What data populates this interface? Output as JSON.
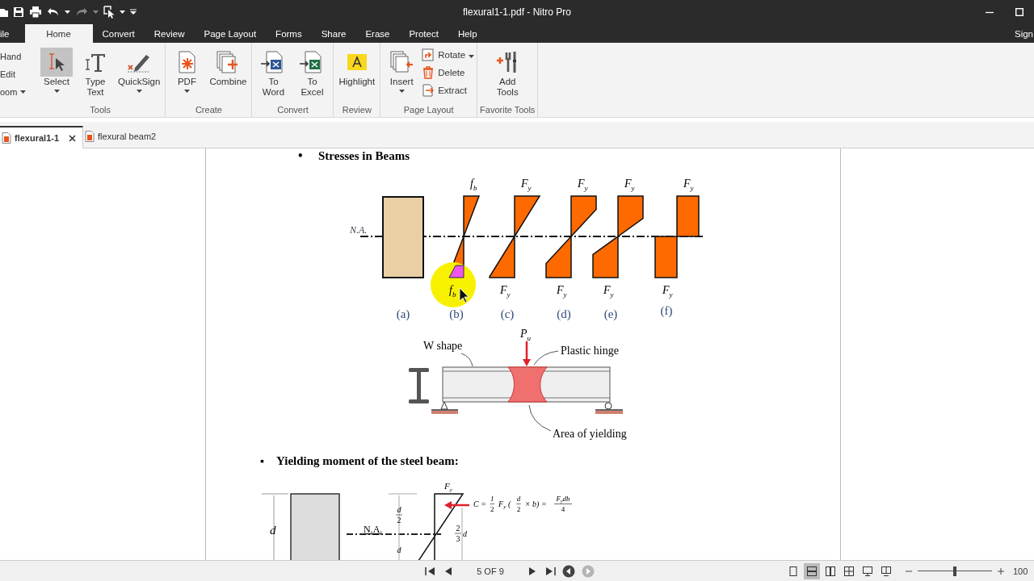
{
  "title_bar": {
    "title": "flexural1-1.pdf - Nitro Pro"
  },
  "menu_tabs": [
    {
      "label": "ile",
      "selected": false
    },
    {
      "label": "Home",
      "selected": true
    },
    {
      "label": "Convert",
      "selected": false
    },
    {
      "label": "Review",
      "selected": false
    },
    {
      "label": "Page Layout",
      "selected": false
    },
    {
      "label": "Forms",
      "selected": false
    },
    {
      "label": "Share",
      "selected": false
    },
    {
      "label": "Erase",
      "selected": false
    },
    {
      "label": "Protect",
      "selected": false
    },
    {
      "label": "Help",
      "selected": false
    }
  ],
  "account_link": "Sign",
  "quick_tools": [
    {
      "label": "Hand",
      "has_menu": false
    },
    {
      "label": "Edit",
      "has_menu": false
    },
    {
      "label": "oom",
      "has_menu": true
    }
  ],
  "ribbon_groups": [
    {
      "label": "Tools",
      "buttons": [
        {
          "kind": "select",
          "lines": [
            "Select"
          ],
          "selected": true,
          "has_menu": true
        },
        {
          "kind": "type-text",
          "lines": [
            "Type",
            "Text"
          ],
          "selected": false,
          "has_menu": false
        },
        {
          "kind": "quicksign",
          "lines": [
            "QuickSign"
          ],
          "selected": false,
          "has_menu": true
        }
      ]
    },
    {
      "label": "Create",
      "buttons": [
        {
          "kind": "pdf",
          "lines": [
            "PDF"
          ],
          "selected": false,
          "has_menu": true
        },
        {
          "kind": "combine",
          "lines": [
            "Combine"
          ],
          "selected": false,
          "has_menu": false
        }
      ]
    },
    {
      "label": "Convert",
      "buttons": [
        {
          "kind": "to-word",
          "lines": [
            "To",
            "Word"
          ],
          "selected": false,
          "has_menu": false
        },
        {
          "kind": "to-excel",
          "lines": [
            "To",
            "Excel"
          ],
          "selected": false,
          "has_menu": false
        }
      ]
    },
    {
      "label": "Review",
      "buttons": [
        {
          "kind": "highlight",
          "lines": [
            "Highlight"
          ],
          "selected": false,
          "has_menu": false
        }
      ]
    },
    {
      "label": "Page Layout",
      "buttons": [
        {
          "kind": "insert",
          "lines": [
            "Insert"
          ],
          "selected": false,
          "has_menu": true
        },
        {
          "kind": "rotate",
          "lines": [
            "Rotate"
          ],
          "selected": false,
          "has_menu": true
        },
        {
          "kind": "delete",
          "lines": [
            "Delete"
          ],
          "selected": false,
          "has_menu": false
        },
        {
          "kind": "extract",
          "lines": [
            "Extract"
          ],
          "selected": false,
          "has_menu": false
        }
      ]
    },
    {
      "label": "Favorite Tools",
      "buttons": [
        {
          "kind": "add-tools",
          "lines": [
            "Add",
            "Tools"
          ],
          "selected": false,
          "has_menu": false
        }
      ]
    }
  ],
  "doc_tabs": [
    {
      "label": "flexural1-1",
      "selected": true,
      "closable": true
    },
    {
      "label": "flexural beam2",
      "selected": false,
      "closable": false
    }
  ],
  "document": {
    "heading_1": {
      "bullet": "•",
      "text": "Stresses in Beams"
    },
    "stress_figure": {
      "na_label": "N.A.",
      "profiles": [
        {
          "kind": "section",
          "caption": "(a)"
        },
        {
          "kind": "elastic",
          "top": {
            "symbol": "f",
            "subscript": "b"
          },
          "bottom": {
            "symbol": "f",
            "subscript": "b"
          },
          "caption": "(b)"
        },
        {
          "kind": "first-yield",
          "top": {
            "symbol": "F",
            "subscript": "y"
          },
          "bottom": {
            "symbol": "F",
            "subscript": "y"
          },
          "caption": "(c)"
        },
        {
          "kind": "partial-yield",
          "top": {
            "symbol": "F",
            "subscript": "y"
          },
          "bottom": {
            "symbol": "F",
            "subscript": "y"
          },
          "caption": "(d)"
        },
        {
          "kind": "deep-yield",
          "top": {
            "symbol": "F",
            "subscript": "y"
          },
          "bottom": {
            "symbol": "F",
            "subscript": "y"
          },
          "caption": "(e)"
        },
        {
          "kind": "plastic",
          "top": {
            "symbol": "F",
            "subscript": "y"
          },
          "bottom": {
            "symbol": "F",
            "subscript": "y"
          },
          "caption": "(f)"
        }
      ]
    },
    "beam_figure": {
      "load_label": {
        "symbol": "P",
        "subscript": "u"
      },
      "section_label": "W shape",
      "hinge_label": "Plastic hinge",
      "yield_label": "Area of yielding"
    },
    "heading_2": {
      "bullet": "▪",
      "text": "Yielding moment of the steel beam:"
    },
    "moment_figure": {
      "depth_label": "d",
      "na_label": "N.A.",
      "stress_label": {
        "symbol": "F",
        "subscript": "y"
      },
      "half_depths": [
        {
          "numerator": "d",
          "denominator": "2"
        },
        {
          "numerator": "d"
        }
      ],
      "lever_arm": {
        "numerator": "2",
        "denominator": "3",
        "rest": "d"
      },
      "formula": [
        {
          "kind": "text",
          "text": "C ="
        },
        {
          "kind": "frac",
          "numerator": "1",
          "denominator": "2"
        },
        {
          "kind": "sym",
          "symbol": "F",
          "subscript": "y"
        },
        {
          "kind": "text",
          "text": "("
        },
        {
          "kind": "frac",
          "numerator": "d",
          "denominator": "2"
        },
        {
          "kind": "text",
          "text": "× b) ="
        },
        {
          "kind": "frac",
          "symbol": "F",
          "subscript": "y",
          "numerator": "db",
          "denominator": "4"
        }
      ]
    }
  },
  "status_bar": {
    "nav": [
      {
        "kind": "first"
      },
      {
        "kind": "prev"
      }
    ],
    "page_field": "5 OF 9",
    "nav_after": [
      {
        "kind": "next"
      },
      {
        "kind": "last"
      }
    ],
    "history": [
      {
        "kind": "back",
        "disabled": false
      },
      {
        "kind": "forward",
        "disabled": true
      }
    ],
    "view_modes": [
      {
        "kind": "single",
        "selected": false
      },
      {
        "kind": "continuous",
        "selected": true
      },
      {
        "kind": "facing",
        "selected": false
      },
      {
        "kind": "facing-continuous",
        "selected": false
      },
      {
        "kind": "presentation",
        "selected": false
      },
      {
        "kind": "split",
        "selected": false
      }
    ],
    "zoom": {
      "level": 0.5,
      "value": "100"
    }
  }
}
